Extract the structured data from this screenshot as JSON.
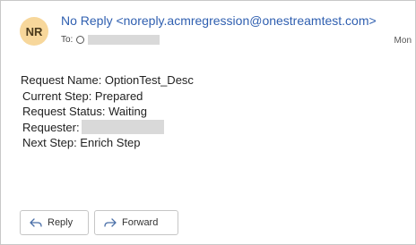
{
  "email": {
    "avatar_initials": "NR",
    "sender": "No Reply <noreply.acmregression@onestreamtest.com>",
    "to_label": "To:",
    "date": "Mon"
  },
  "body": {
    "request_name": "Request Name: OptionTest_Desc",
    "current_step": "Current Step: Prepared",
    "request_status": "Request Status: Waiting",
    "requester_label": "Requester:",
    "next_step": "Next Step: Enrich Step"
  },
  "actions": {
    "reply_label": "Reply",
    "forward_label": "Forward"
  },
  "colors": {
    "sender_link": "#2f5fb0",
    "avatar_bg": "#f7d79b",
    "redaction": "#d9d9d9"
  },
  "icons": {
    "reply": "reply-arrow-icon",
    "forward": "forward-arrow-icon"
  }
}
